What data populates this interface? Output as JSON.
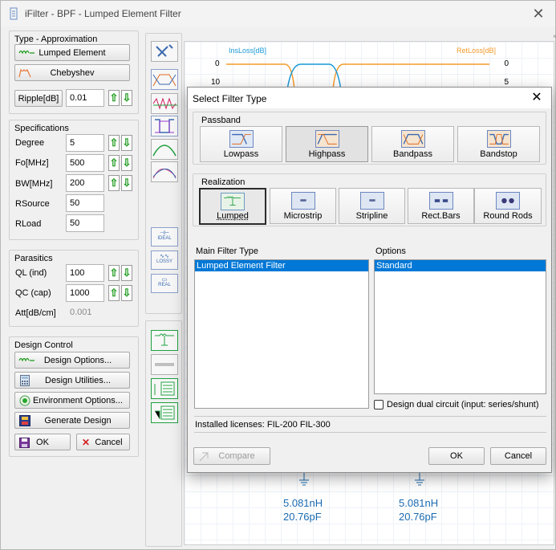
{
  "main": {
    "title": "iFilter - BPF - Lumped Element Filter",
    "type_group": {
      "title": "Type - Approximation",
      "topology_label": "Lumped Element",
      "approximation_label": "Chebyshev",
      "ripple_label": "Ripple[dB]",
      "ripple_value": "0.01"
    },
    "specs": {
      "title": "Specifications",
      "degree_label": "Degree",
      "degree_value": "5",
      "fo_label": "Fo[MHz]",
      "fo_value": "500",
      "bw_label": "BW[MHz]",
      "bw_value": "200",
      "rsource_label": "RSource",
      "rsource_value": "50",
      "rload_label": "RLoad",
      "rload_value": "50"
    },
    "parasitics": {
      "title": "Parasitics",
      "ql_label": "QL (ind)",
      "ql_value": "100",
      "qc_label": "QC (cap)",
      "qc_value": "1000",
      "att_label": "Att[dB/cm]",
      "att_value": "0.001"
    },
    "design_control": {
      "title": "Design Control",
      "design_options": "Design Options...",
      "design_utilities": "Design Utilities...",
      "environment_options": "Environment Options...",
      "generate_design": "Generate Design",
      "ok": "OK",
      "cancel": "Cancel"
    },
    "chart": {
      "left_axis_label": "InsLoss[dB]",
      "right_axis_label": "RetLoss[dB]",
      "left_ticks": [
        "0",
        "10"
      ],
      "right_ticks": [
        "0",
        "5"
      ],
      "component_values": [
        {
          "l": "5.081nH",
          "c": "20.76pF"
        },
        {
          "l": "5.081nH",
          "c": "20.76pF"
        }
      ],
      "insloss_color": "#1a9ad6",
      "retloss_color": "#f39a2a"
    },
    "side_labels": {
      "ideal": "IDEAL",
      "lossy": "LOSSY",
      "real": "REAL"
    }
  },
  "dialog": {
    "title": "Select Filter Type",
    "passband_title": "Passband",
    "passband_options": [
      "Lowpass",
      "Highpass",
      "Bandpass",
      "Bandstop"
    ],
    "passband_selected": "Highpass",
    "realization_title": "Realization",
    "realization_options": [
      "Lumped",
      "Microstrip",
      "Stripline",
      "Rect.Bars",
      "Round Rods"
    ],
    "realization_selected": "Lumped",
    "main_filter_type_title": "Main Filter Type",
    "main_filter_type_items": [
      "Lumped Element Filter"
    ],
    "options_title": "Options",
    "options_items": [
      "Standard"
    ],
    "dual_circuit_label": "Design dual circuit (input: series/shunt)",
    "dual_circuit_checked": false,
    "installed_licenses": "Installed licenses:  FIL-200  FIL-300",
    "compare": "Compare",
    "ok": "OK",
    "cancel": "Cancel"
  }
}
